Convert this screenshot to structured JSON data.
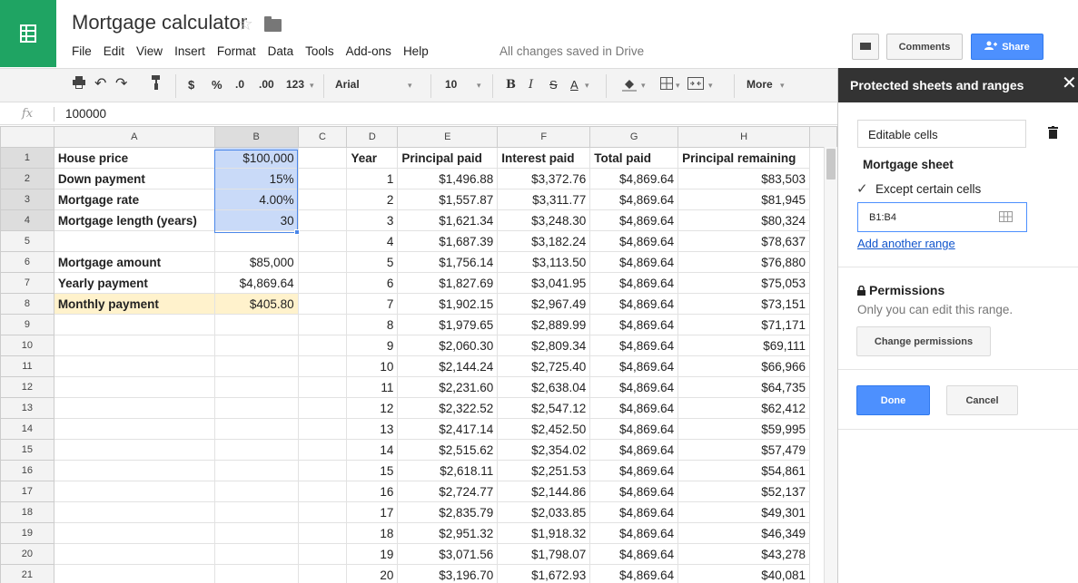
{
  "app": {
    "title": "Mortgage calculator",
    "menu": [
      "File",
      "Edit",
      "View",
      "Insert",
      "Format",
      "Data",
      "Tools",
      "Add-ons",
      "Help"
    ],
    "save_status": "All changes saved in Drive",
    "comments_label": "Comments",
    "share_label": "Share"
  },
  "toolbar": {
    "currency": "$",
    "percent": "%",
    "dec_less": ".0",
    "dec_more": ".00",
    "format_more": "123",
    "font": "Arial",
    "size": "10",
    "bold": "B",
    "italic": "I",
    "strike": "S",
    "textcolor": "A",
    "more": "More"
  },
  "formula": {
    "fx": "fx",
    "value": "100000"
  },
  "sheet": {
    "col_headers": [
      "A",
      "B",
      "C",
      "D",
      "E",
      "F",
      "G",
      "H"
    ],
    "rows": [
      [
        "House price",
        "$100,000",
        "",
        "Year",
        "Principal paid",
        "Interest paid",
        "Total paid",
        "Principal remaining"
      ],
      [
        "Down payment",
        "15%",
        "",
        "1",
        "$1,496.88",
        "$3,372.76",
        "$4,869.64",
        "$83,503"
      ],
      [
        "Mortgage rate",
        "4.00%",
        "",
        "2",
        "$1,557.87",
        "$3,311.77",
        "$4,869.64",
        "$81,945"
      ],
      [
        "Mortgage length (years)",
        "30",
        "",
        "3",
        "$1,621.34",
        "$3,248.30",
        "$4,869.64",
        "$80,324"
      ],
      [
        "",
        "",
        "",
        "4",
        "$1,687.39",
        "$3,182.24",
        "$4,869.64",
        "$78,637"
      ],
      [
        "Mortgage amount",
        "$85,000",
        "",
        "5",
        "$1,756.14",
        "$3,113.50",
        "$4,869.64",
        "$76,880"
      ],
      [
        "Yearly payment",
        "$4,869.64",
        "",
        "6",
        "$1,827.69",
        "$3,041.95",
        "$4,869.64",
        "$75,053"
      ],
      [
        "Monthly payment",
        "$405.80",
        "",
        "7",
        "$1,902.15",
        "$2,967.49",
        "$4,869.64",
        "$73,151"
      ],
      [
        "",
        "",
        "",
        "8",
        "$1,979.65",
        "$2,889.99",
        "$4,869.64",
        "$71,171"
      ],
      [
        "",
        "",
        "",
        "9",
        "$2,060.30",
        "$2,809.34",
        "$4,869.64",
        "$69,111"
      ],
      [
        "",
        "",
        "",
        "10",
        "$2,144.24",
        "$2,725.40",
        "$4,869.64",
        "$66,966"
      ],
      [
        "",
        "",
        "",
        "11",
        "$2,231.60",
        "$2,638.04",
        "$4,869.64",
        "$64,735"
      ],
      [
        "",
        "",
        "",
        "12",
        "$2,322.52",
        "$2,547.12",
        "$4,869.64",
        "$62,412"
      ],
      [
        "",
        "",
        "",
        "13",
        "$2,417.14",
        "$2,452.50",
        "$4,869.64",
        "$59,995"
      ],
      [
        "",
        "",
        "",
        "14",
        "$2,515.62",
        "$2,354.02",
        "$4,869.64",
        "$57,479"
      ],
      [
        "",
        "",
        "",
        "15",
        "$2,618.11",
        "$2,251.53",
        "$4,869.64",
        "$54,861"
      ],
      [
        "",
        "",
        "",
        "16",
        "$2,724.77",
        "$2,144.86",
        "$4,869.64",
        "$52,137"
      ],
      [
        "",
        "",
        "",
        "17",
        "$2,835.79",
        "$2,033.85",
        "$4,869.64",
        "$49,301"
      ],
      [
        "",
        "",
        "",
        "18",
        "$2,951.32",
        "$1,918.32",
        "$4,869.64",
        "$46,349"
      ],
      [
        "",
        "",
        "",
        "19",
        "$3,071.56",
        "$1,798.07",
        "$4,869.64",
        "$43,278"
      ],
      [
        "",
        "",
        "",
        "20",
        "$3,196.70",
        "$1,672.93",
        "$4,869.64",
        "$40,081"
      ]
    ]
  },
  "panel": {
    "title": "Protected sheets and ranges",
    "range_description": "Editable cells",
    "sheet_name": "Mortgage sheet",
    "except_label": "Except certain cells",
    "except_checked": true,
    "range": "B1:B4",
    "add_range": "Add another range",
    "permissions_title": "Permissions",
    "permissions_desc": "Only you can edit this range.",
    "change_permissions": "Change permissions",
    "done": "Done",
    "cancel": "Cancel"
  }
}
